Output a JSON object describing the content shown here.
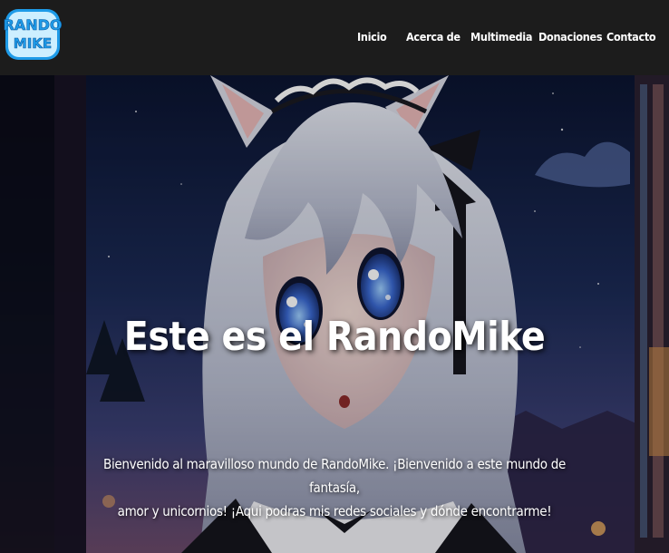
{
  "brand": {
    "logo_text_line1": "RANDO",
    "logo_text_line2": "MIKE",
    "logo_colors": {
      "fill": "#ffffff",
      "outline": "#1e9be8"
    }
  },
  "nav": {
    "items": [
      {
        "label": "Inicio"
      },
      {
        "label": "Acerca de"
      },
      {
        "label": "Multimedia"
      },
      {
        "label": "Donaciones"
      },
      {
        "label": "Contacto"
      }
    ]
  },
  "hero": {
    "title": "Este es el RandoMike",
    "subtitle_line1": "Bienvenido al maravilloso mundo de RandoMike. ¡Bienvenido a este mundo de fantasía,",
    "subtitle_line2": "amor y unicornios! ¡Aqui podras mis redes sociales y dónde encontrarme!",
    "background_image": "anime-catgirl-maid-night-sky-illustration"
  },
  "colors": {
    "header_bg": "#1c1c1c",
    "text": "#ffffff",
    "sky_top": "#0e1a3a",
    "sky_bottom": "#3a3a6a",
    "hair": "#cfd3e0",
    "eyes": "#3a5fc8"
  }
}
